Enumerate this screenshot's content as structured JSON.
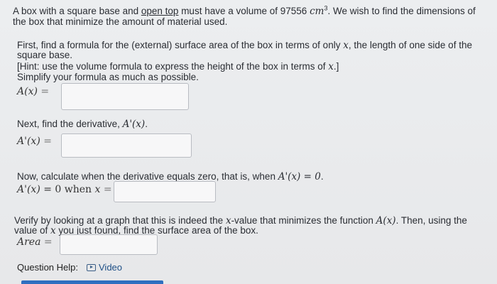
{
  "problem": {
    "intro_pre": "A box with a square base and ",
    "intro_underline": "open top",
    "intro_mid": " must have a volume of 97556 ",
    "unit": "cm",
    "unit_exp": "3",
    "intro_post": ". We wish to find the dimensions of",
    "intro_line2": "the box that minimize the amount of material used."
  },
  "step1": {
    "line1_pre": "First, find a formula for the (external) surface area of the box in terms of only ",
    "var": "x",
    "line1_post": ", the length of one side of the",
    "line2": "square base.",
    "hint_pre": "[Hint: use the volume formula to express the height of the box in terms of ",
    "hint_post": ".]",
    "simplify": "Simplify your formula as much as possible.",
    "label": "A(x)",
    "equals": "="
  },
  "step2": {
    "text_pre": "Next, find the derivative, ",
    "deriv": "A'(x)",
    "text_post": ".",
    "label": "A'(x)",
    "equals": "="
  },
  "step3": {
    "text_pre": "Now, calculate when the derivative equals zero, that is, when ",
    "condition": "A'(x) = 0",
    "text_post": ".",
    "label": "A'(x)",
    "equals_zero": "= 0 when",
    "var": "x",
    "equals": "="
  },
  "step4": {
    "line1_pre": "Verify by looking at a graph that this is indeed the ",
    "var": "x",
    "line1_mid": "-value that minimizes the function ",
    "func": "A(x)",
    "line1_post": ". Then, using the",
    "line2_pre": "value of ",
    "line2_post": " you just found, find the surface area of the box.",
    "label": "Area",
    "equals": "="
  },
  "help": {
    "label": "Question Help:",
    "video": "Video"
  },
  "answers": {
    "area_formula": "",
    "derivative": "",
    "critical_x": "",
    "area_value": ""
  }
}
